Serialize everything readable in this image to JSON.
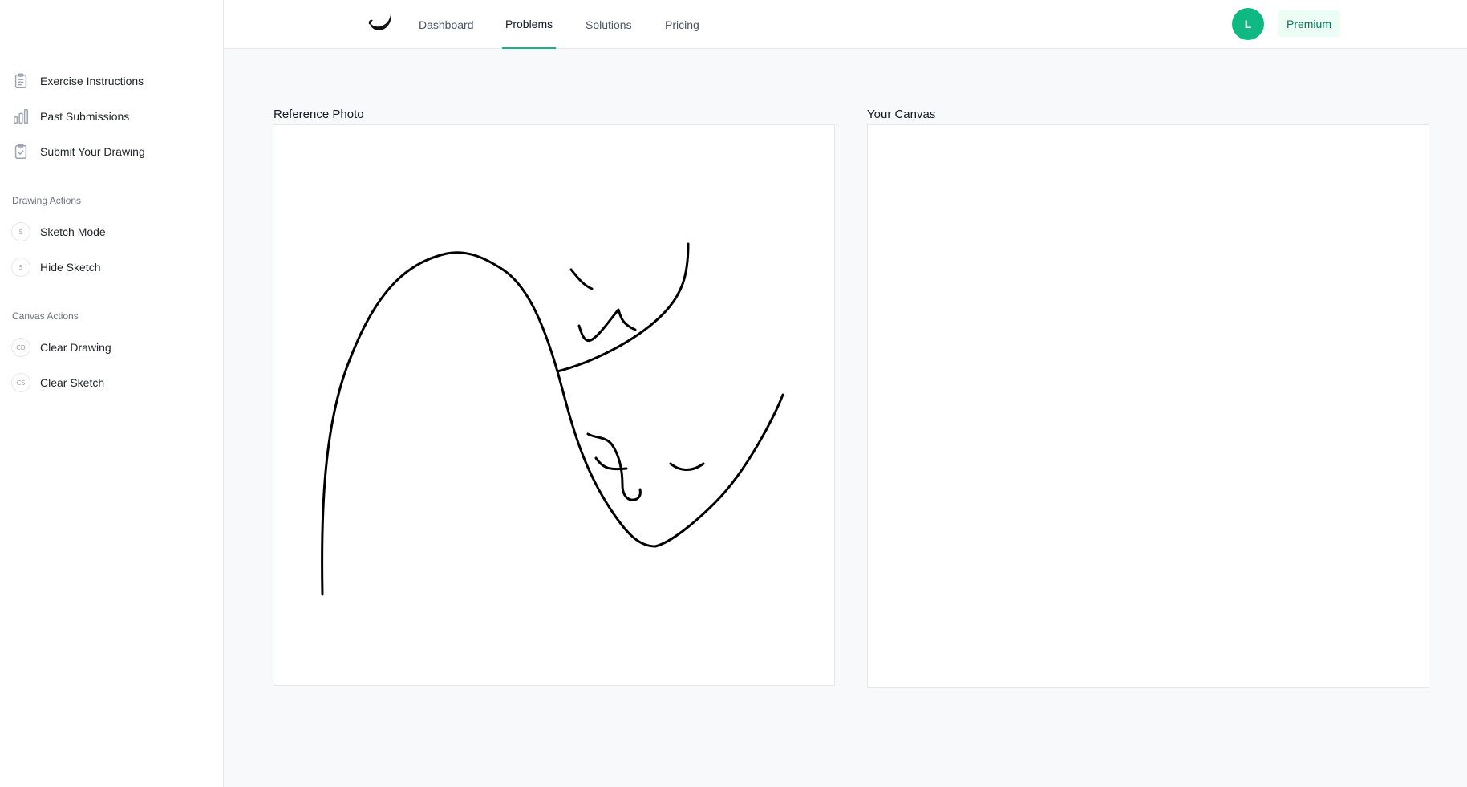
{
  "sidebar": {
    "items": [
      {
        "label": "Exercise Instructions",
        "icon": "clipboard-icon"
      },
      {
        "label": "Past Submissions",
        "icon": "bar-chart-icon"
      },
      {
        "label": "Submit Your Drawing",
        "icon": "clipboard-check-icon"
      }
    ],
    "drawing_actions": {
      "title": "Drawing Actions",
      "items": [
        {
          "label": "Sketch Mode",
          "key": "S"
        },
        {
          "label": "Hide Sketch",
          "key": "S"
        }
      ]
    },
    "canvas_actions": {
      "title": "Canvas Actions",
      "items": [
        {
          "label": "Clear Drawing",
          "key": "CD"
        },
        {
          "label": "Clear Sketch",
          "key": "CS"
        }
      ]
    }
  },
  "nav": {
    "links": [
      "Dashboard",
      "Problems",
      "Solutions",
      "Pricing"
    ],
    "active": "Problems",
    "avatar_letter": "L",
    "premium_label": "Premium"
  },
  "reference": {
    "title": "Reference Photo"
  },
  "canvas": {
    "title": "Your Canvas"
  },
  "colors": {
    "accent": "#10b981",
    "premium_bg": "#ecfdf5",
    "premium_text": "#047857"
  }
}
